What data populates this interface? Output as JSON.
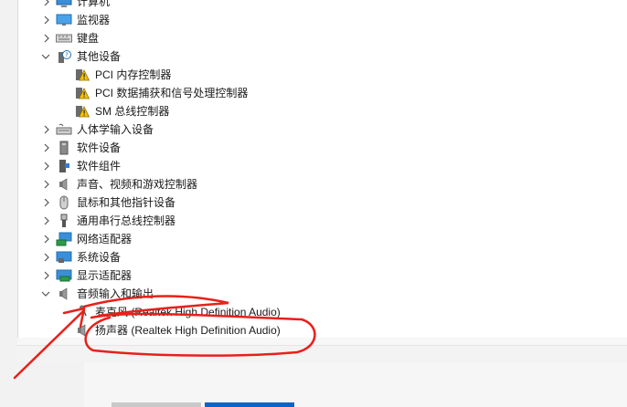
{
  "tree": {
    "items": [
      {
        "label": "计算机",
        "icon": "computer-icon",
        "expanded": false,
        "level": 0
      },
      {
        "label": "监视器",
        "icon": "monitor-icon",
        "expanded": false,
        "level": 0
      },
      {
        "label": "键盘",
        "icon": "keyboard-icon",
        "expanded": false,
        "level": 0
      },
      {
        "label": "其他设备",
        "icon": "unknown-device-icon",
        "expanded": true,
        "level": 0
      },
      {
        "label": "PCI 内存控制器",
        "icon": "warning-device-icon",
        "level": 1
      },
      {
        "label": "PCI 数据捕获和信号处理控制器",
        "icon": "warning-device-icon",
        "level": 1
      },
      {
        "label": "SM 总线控制器",
        "icon": "warning-device-icon",
        "level": 1
      },
      {
        "label": "人体学输入设备",
        "icon": "hid-icon",
        "expanded": false,
        "level": 0
      },
      {
        "label": "软件设备",
        "icon": "software-device-icon",
        "expanded": false,
        "level": 0
      },
      {
        "label": "软件组件",
        "icon": "software-component-icon",
        "expanded": false,
        "level": 0
      },
      {
        "label": "声音、视频和游戏控制器",
        "icon": "speaker-icon",
        "expanded": false,
        "level": 0
      },
      {
        "label": "鼠标和其他指针设备",
        "icon": "mouse-icon",
        "expanded": false,
        "level": 0
      },
      {
        "label": "通用串行总线控制器",
        "icon": "usb-icon",
        "expanded": false,
        "level": 0
      },
      {
        "label": "网络适配器",
        "icon": "network-icon",
        "expanded": false,
        "level": 0
      },
      {
        "label": "系统设备",
        "icon": "system-device-icon",
        "expanded": false,
        "level": 0
      },
      {
        "label": "显示适配器",
        "icon": "display-adapter-icon",
        "expanded": false,
        "level": 0
      },
      {
        "label": "音频输入和输出",
        "icon": "speaker-icon",
        "expanded": true,
        "level": 0
      },
      {
        "label": "麦克风 (Realtek High Definition Audio)",
        "icon": "microphone-icon",
        "level": 1
      },
      {
        "label": "扬声器 (Realtek High Definition Audio)",
        "icon": "speaker-icon",
        "level": 1
      }
    ]
  },
  "colors": {
    "annotation": "#e8201a",
    "accent": "#0a64c8",
    "warning": "#f5c400"
  }
}
